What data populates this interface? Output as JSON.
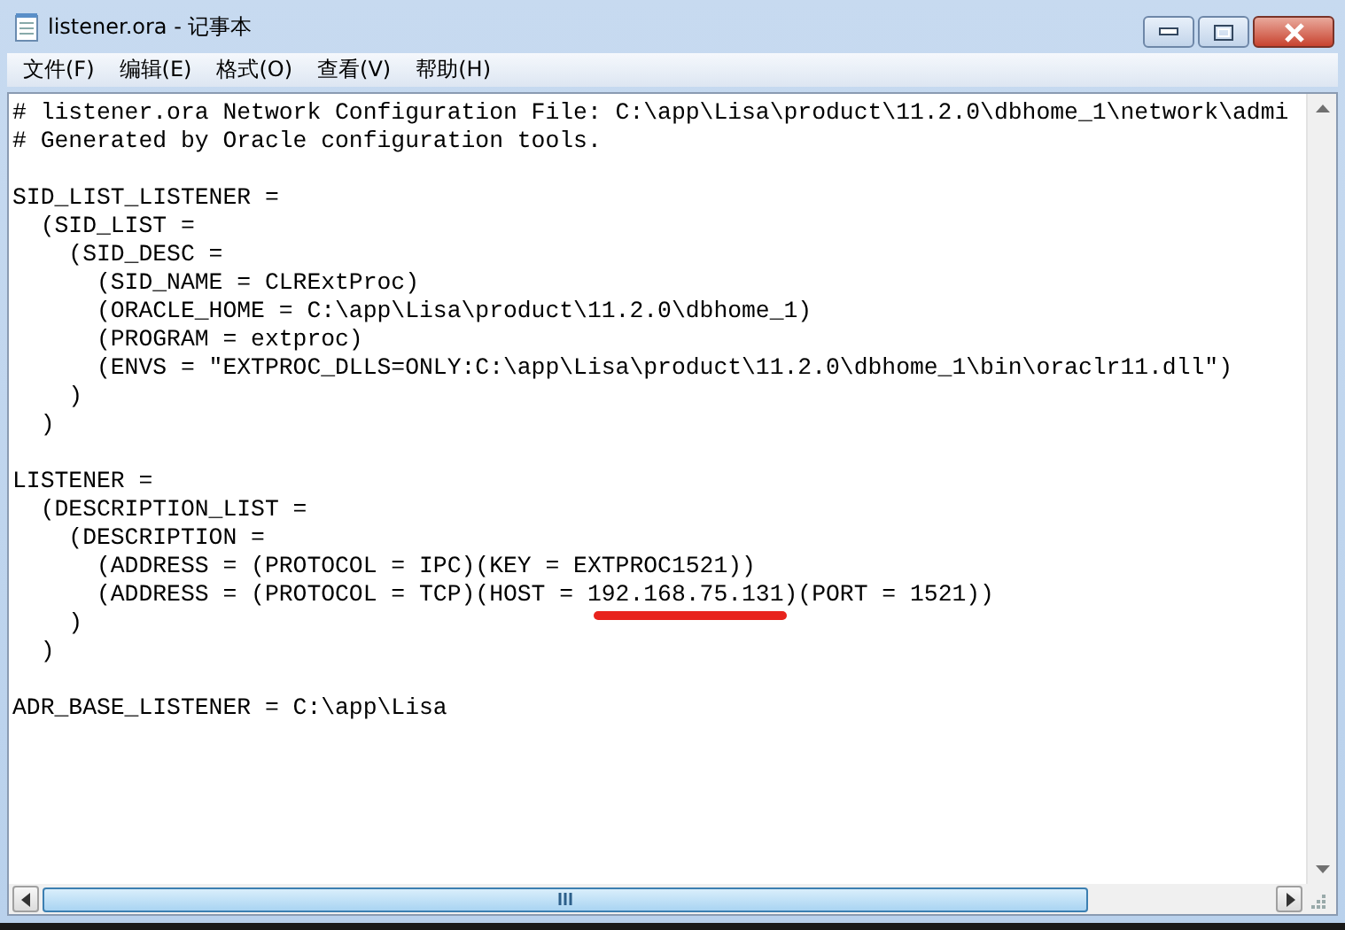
{
  "window": {
    "title": "listener.ora - 记事本"
  },
  "menu": [
    "文件(F)",
    "编辑(E)",
    "格式(O)",
    "查看(V)",
    "帮助(H)"
  ],
  "editor": {
    "lines": [
      {
        "kind": "plain",
        "text": "# listener.ora Network Configuration File: C:\\app\\Lisa\\product\\11.2.0\\dbhome_1\\network\\admi"
      },
      {
        "kind": "plain",
        "text": "# Generated by Oracle configuration tools."
      },
      {
        "kind": "blank"
      },
      {
        "kind": "plain",
        "text": "SID_LIST_LISTENER ="
      },
      {
        "kind": "plain",
        "text": "  (SID_LIST ="
      },
      {
        "kind": "plain",
        "text": "    (SID_DESC ="
      },
      {
        "kind": "plain",
        "text": "      (SID_NAME = CLRExtProc)"
      },
      {
        "kind": "plain",
        "text": "      (ORACLE_HOME = C:\\app\\Lisa\\product\\11.2.0\\dbhome_1)"
      },
      {
        "kind": "plain",
        "text": "      (PROGRAM = extproc)"
      },
      {
        "kind": "plain",
        "text": "      (ENVS = \"EXTPROC_DLLS=ONLY:C:\\app\\Lisa\\product\\11.2.0\\dbhome_1\\bin\\oraclr11.dll\")"
      },
      {
        "kind": "plain",
        "text": "    )"
      },
      {
        "kind": "plain",
        "text": "  )"
      },
      {
        "kind": "blank"
      },
      {
        "kind": "plain",
        "text": "LISTENER ="
      },
      {
        "kind": "plain",
        "text": "  (DESCRIPTION_LIST ="
      },
      {
        "kind": "plain",
        "text": "    (DESCRIPTION ="
      },
      {
        "kind": "plain",
        "text": "      (ADDRESS = (PROTOCOL = IPC)(KEY = EXTPROC1521))"
      },
      {
        "kind": "marked",
        "before": "      (ADDRESS = (PROTOCOL = TCP)(HOST = ",
        "marked": "192.168.75.131",
        "after": ")(PORT = 1521))"
      },
      {
        "kind": "plain",
        "text": "    )"
      },
      {
        "kind": "plain",
        "text": "  )"
      },
      {
        "kind": "blank"
      },
      {
        "kind": "plain",
        "text": "ADR_BASE_LISTENER = C:\\app\\Lisa"
      }
    ]
  }
}
